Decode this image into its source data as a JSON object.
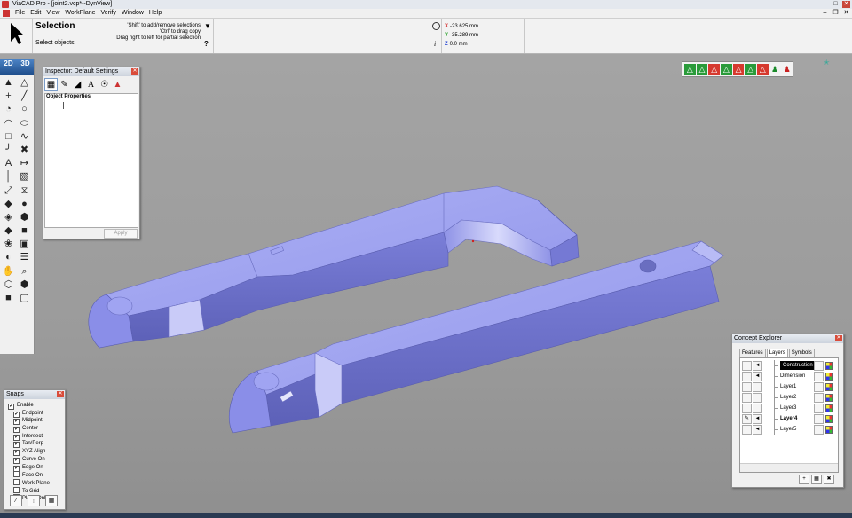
{
  "window": {
    "title": "ViaCAD Pro - [joint2.vcp*--DynView]"
  },
  "menu": [
    "File",
    "Edit",
    "View",
    "WorkPlane",
    "Verify",
    "Window",
    "Help"
  ],
  "toolbar": {
    "mode_title": "Selection",
    "mode_sub": "Select objects",
    "hints": [
      "'Shift' to add/remove selections",
      "'Ctrl' to drag copy",
      "Drag right to left for partial selection"
    ],
    "coords": {
      "x_label": "X",
      "x": "-23.625 mm",
      "y_label": "Y",
      "y": "-35.289 mm",
      "z_label": "Z",
      "z": "0.0 mm"
    },
    "info_icon": "i"
  },
  "mode_tabs": [
    "2D",
    "3D"
  ],
  "tools": [
    {
      "name": "select-arrow-icon",
      "glyph": "▲"
    },
    {
      "name": "subselect-arrow-icon",
      "glyph": "△"
    },
    {
      "name": "point-icon",
      "glyph": "+"
    },
    {
      "name": "line-icon",
      "glyph": "╱"
    },
    {
      "name": "arc-icon",
      "glyph": "◔"
    },
    {
      "name": "circle-icon",
      "glyph": "○"
    },
    {
      "name": "arc-3pt-icon",
      "glyph": "◠"
    },
    {
      "name": "ellipse-icon",
      "glyph": "⬭"
    },
    {
      "name": "rectangle-icon",
      "glyph": "□"
    },
    {
      "name": "spline-icon",
      "glyph": "∿"
    },
    {
      "name": "fillet-icon",
      "glyph": "╯"
    },
    {
      "name": "trim-icon",
      "glyph": "✖"
    },
    {
      "name": "text-icon",
      "glyph": "A"
    },
    {
      "name": "dimension-icon",
      "glyph": "↦"
    },
    {
      "name": "hatch-icon",
      "glyph": "│"
    },
    {
      "name": "pattern-icon",
      "glyph": "▧"
    },
    {
      "name": "transform-icon",
      "glyph": "⤢"
    },
    {
      "name": "mirror-icon",
      "glyph": "⧖"
    },
    {
      "name": "solid-extrude-icon",
      "glyph": "◆"
    },
    {
      "name": "sphere-icon",
      "glyph": "●"
    },
    {
      "name": "solid-modify-icon",
      "glyph": "◈"
    },
    {
      "name": "boolean-icon",
      "glyph": "⬢"
    },
    {
      "name": "shell-icon",
      "glyph": "◆"
    },
    {
      "name": "box-icon",
      "glyph": "■"
    },
    {
      "name": "surface-icon",
      "glyph": "❀"
    },
    {
      "name": "solid-edit-icon",
      "glyph": "▣"
    },
    {
      "name": "light-icon",
      "glyph": "◐"
    },
    {
      "name": "sheet-icon",
      "glyph": "☰"
    },
    {
      "name": "pan-hand-icon",
      "glyph": "✋"
    },
    {
      "name": "zoom-icon",
      "glyph": "⌕"
    },
    {
      "name": "view-iso-icon",
      "glyph": "⬡"
    },
    {
      "name": "view-cube-icon",
      "glyph": "⬢"
    },
    {
      "name": "view-render-icon",
      "glyph": "■"
    },
    {
      "name": "view-wire-icon",
      "glyph": "▢"
    }
  ],
  "inspector": {
    "title": "Inspector: Default Settings",
    "section": "Object Properties",
    "apply": "Apply",
    "icons": [
      "object-icon",
      "pen-icon",
      "fill-icon",
      "text-style-icon",
      "light-icon",
      "render-icon"
    ]
  },
  "snaps": {
    "title": "Snaps",
    "items": [
      {
        "label": "Enable",
        "checked": true,
        "indent": false
      },
      {
        "label": "Endpoint",
        "checked": true,
        "indent": true
      },
      {
        "label": "Midpoint",
        "checked": true,
        "indent": true
      },
      {
        "label": "Center",
        "checked": true,
        "indent": true
      },
      {
        "label": "Intersect",
        "checked": true,
        "indent": true
      },
      {
        "label": "Tan/Perp",
        "checked": true,
        "indent": true
      },
      {
        "label": "XYZ Align",
        "checked": true,
        "indent": true
      },
      {
        "label": "Curve On",
        "checked": true,
        "indent": true
      },
      {
        "label": "Edge On",
        "checked": true,
        "indent": true
      },
      {
        "label": "Face On",
        "checked": false,
        "indent": true
      },
      {
        "label": "Work Plane",
        "checked": false,
        "indent": true
      },
      {
        "label": "To Grid",
        "checked": false,
        "indent": true
      },
      {
        "label": "Plane Only",
        "checked": false,
        "indent": true
      }
    ]
  },
  "concept_explorer": {
    "title": "Concept Explorer",
    "tabs": [
      "Features",
      "Layers",
      "Symbols"
    ],
    "active_tab": "Layers",
    "layers": [
      {
        "name": "Construction",
        "current": true,
        "bold": false,
        "visible": true,
        "editing": false
      },
      {
        "name": "Dimension",
        "current": false,
        "bold": false,
        "visible": true,
        "editing": false
      },
      {
        "name": "Layer1",
        "current": false,
        "bold": false,
        "visible": false,
        "editing": false
      },
      {
        "name": "Layer2",
        "current": false,
        "bold": false,
        "visible": false,
        "editing": false
      },
      {
        "name": "Layer3",
        "current": false,
        "bold": false,
        "visible": false,
        "editing": false
      },
      {
        "name": "Layer4",
        "current": false,
        "bold": true,
        "visible": true,
        "editing": true
      },
      {
        "name": "Layer5",
        "current": false,
        "bold": false,
        "visible": true,
        "editing": false
      }
    ]
  },
  "colors": {
    "part": "#8a8ee8",
    "part_top": "#a6aaf2",
    "part_dark": "#6c70c8",
    "viewport": "#9b9b9b"
  }
}
